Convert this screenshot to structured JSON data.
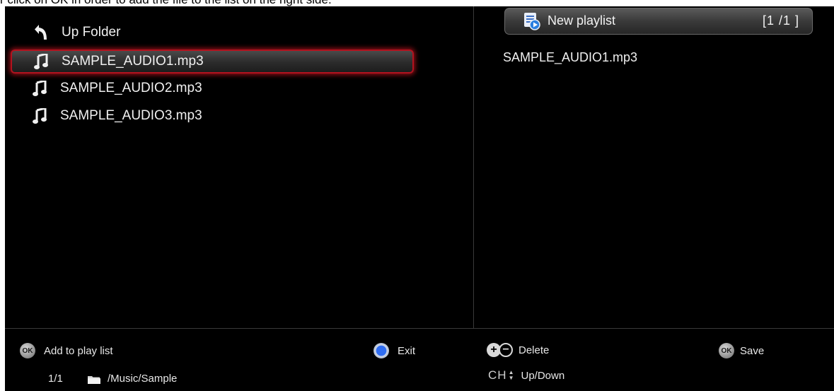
{
  "caption": "r click on OK in order to add the file to the list on the right side.",
  "file_browser": {
    "up_folder_label": "Up Folder",
    "files": [
      {
        "name": "SAMPLE_AUDIO1.mp3",
        "selected": true
      },
      {
        "name": "SAMPLE_AUDIO2.mp3",
        "selected": false
      },
      {
        "name": "SAMPLE_AUDIO3.mp3",
        "selected": false
      }
    ]
  },
  "playlist": {
    "title": "New playlist",
    "count": "[1 /1 ]",
    "entries": [
      "SAMPLE_AUDIO1.mp3"
    ]
  },
  "footer": {
    "ok_badge": "OK",
    "add_label": "Add to play list",
    "exit_label": "Exit",
    "delete_label": "Delete",
    "save_label": "Save",
    "ch_label": "CH",
    "updown_label": "Up/Down",
    "page_indicator": "1/1",
    "path": "/Music/Sample"
  },
  "colors": {
    "background": "#000000",
    "selection_border": "#b3121e",
    "exit_button": "#2f6df2"
  }
}
